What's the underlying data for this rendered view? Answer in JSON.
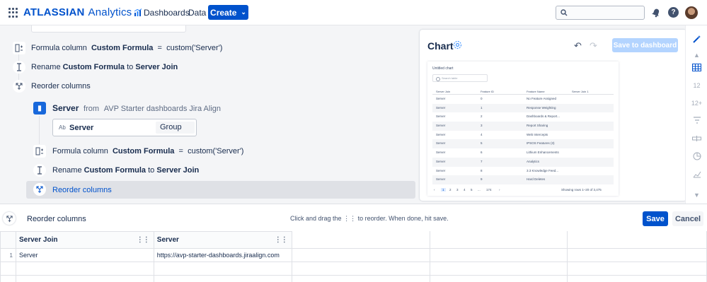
{
  "topbar": {
    "brand": "ATLASSIAN",
    "brand_sub": "Analytics",
    "nav": [
      "Dashboards",
      "Data"
    ],
    "create_label": "Create",
    "search_placeholder": ""
  },
  "steps": {
    "formula1": {
      "prefix": "Formula column",
      "name": "Custom Formula",
      "eq": "=",
      "expr": "custom('Server')"
    },
    "rename1": {
      "prefix": "Rename",
      "from": "Custom Formula",
      "to_word": "to",
      "to": "Server Join"
    },
    "reorder1": {
      "label": "Reorder columns"
    },
    "datasource": {
      "name": "Server",
      "from_word": "from",
      "source": "AVP Starter dashboards Jira Align"
    },
    "ds_table": {
      "type_abbr": "Ab",
      "column": "Server",
      "role": "Group"
    },
    "formula2": {
      "prefix": "Formula column",
      "name": "Custom Formula",
      "eq": "=",
      "expr": "custom('Server')"
    },
    "rename2": {
      "prefix": "Rename",
      "from": "Custom Formula",
      "to_word": "to",
      "to": "Server Join"
    },
    "reorder2": {
      "label": "Reorder columns"
    }
  },
  "chart": {
    "title": "Chart",
    "save_to_dashboard": "Save to dashboard",
    "preview_title": "Untitled chart",
    "preview_search": "Search table",
    "preview_headers": [
      "Server Join",
      "Feature ID",
      "Feature Name",
      "Server Join 1"
    ],
    "preview_rows": [
      [
        "Server",
        "0",
        "No Feature Assigned"
      ],
      [
        "Server",
        "1",
        "Response Weighting"
      ],
      [
        "Server",
        "2",
        "Dashboards & Report..."
      ],
      [
        "Server",
        "3",
        "Report Sharing"
      ],
      [
        "Server",
        "4",
        "Web Intercepts"
      ],
      [
        "Server",
        "5",
        "IPSOS Features (3)"
      ],
      [
        "Server",
        "6",
        "Lithium Enhancements"
      ],
      [
        "Server",
        "7",
        "Analytics"
      ],
      [
        "Server",
        "8",
        "3.3 Knowledge Feed..."
      ],
      [
        "Server",
        "9",
        "Hard Deletes"
      ]
    ],
    "pager": [
      "1",
      "2",
      "3",
      "4",
      "5",
      "...",
      "174"
    ],
    "showing": "Showing rows 1–20 of 3,475"
  },
  "rail": {
    "icons": [
      "magic-wand-icon",
      "table-icon",
      "number-icon",
      "number-plus-icon",
      "filter-icon",
      "bar-icon",
      "pie-icon",
      "line-icon"
    ],
    "labels": {
      "n1": "12",
      "n2": "12+"
    }
  },
  "bottom": {
    "title": "Reorder columns",
    "hint_pre": "Click and drag the",
    "hint_post": "to reorder. When done, hit save.",
    "save": "Save",
    "cancel": "Cancel",
    "columns": [
      "Server Join",
      "Server"
    ],
    "rows": [
      {
        "num": "1",
        "server_join": "Server",
        "server": "https://avp-starter-dashboards.jiraalign.com"
      }
    ]
  }
}
